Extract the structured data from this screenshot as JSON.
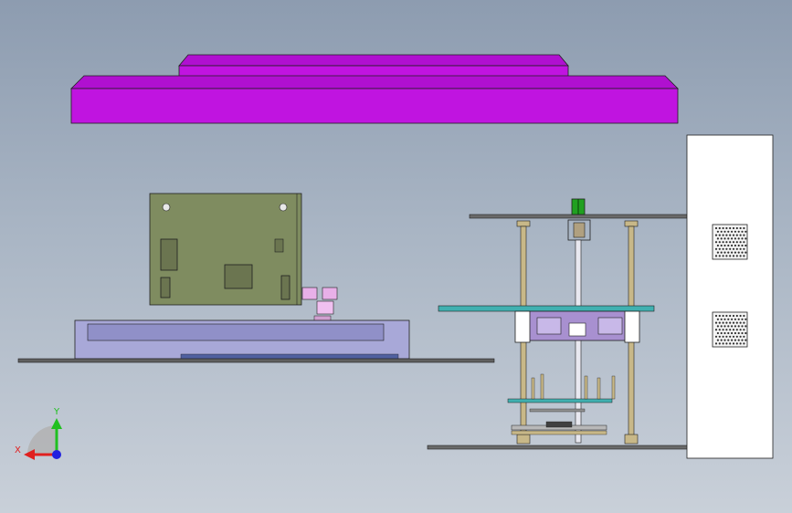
{
  "viewport": {
    "background_top": "#8d9cb0",
    "background_bottom": "#c9d0d9"
  },
  "colors": {
    "magenta_part": "#c014e0",
    "magenta_top": "#b010d0",
    "magenta_edge": "#6a0a80",
    "pcb_green": "#7f8c60",
    "base_blue": "#a8a8d8",
    "plate_teal": "#40b0b0",
    "rod_tan": "#c8b888",
    "bracket_purple": "#a890d0",
    "cabinet_white": "#ffffff",
    "outline": "#202020"
  },
  "triad": {
    "x_label": "X",
    "y_label": "Y",
    "x_color": "#e02020",
    "y_color": "#20c020",
    "z_color": "#2020e0"
  }
}
